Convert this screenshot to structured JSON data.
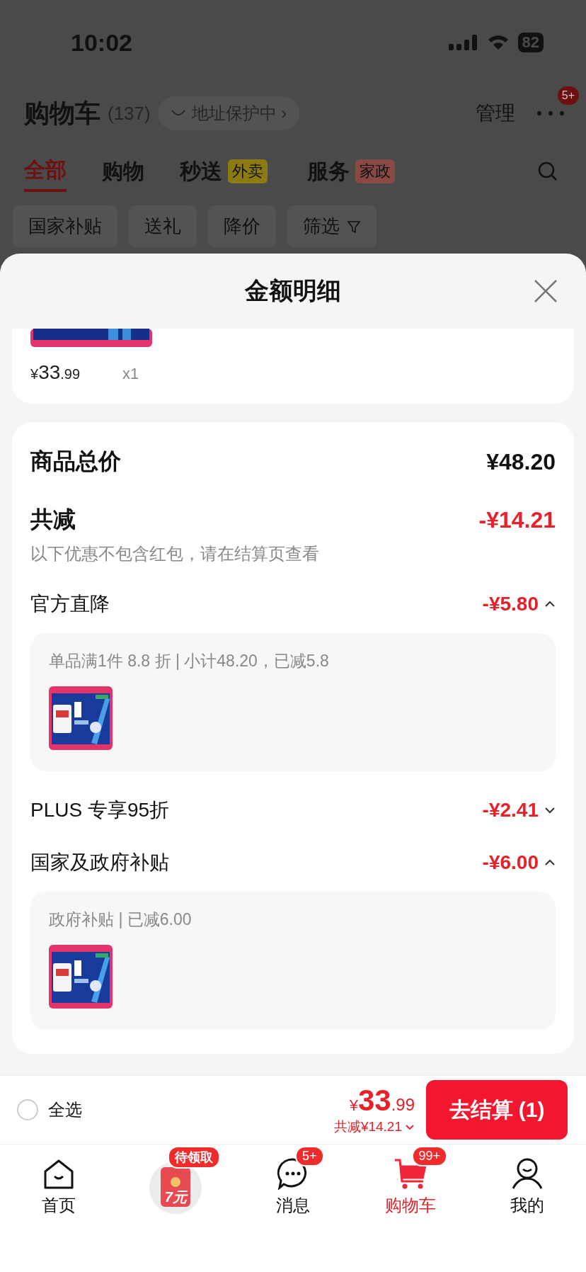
{
  "status_bar": {
    "time": "10:02",
    "battery": "82"
  },
  "header": {
    "title": "购物车",
    "count": "(137)",
    "address_badge": "地址保护中",
    "address_chevron": "›",
    "manage": "管理",
    "more_badge": "5+"
  },
  "tabs": [
    {
      "label": "全部",
      "selected": true
    },
    {
      "label": "购物",
      "selected": false
    },
    {
      "label": "秒送",
      "selected": false,
      "tag": {
        "label": "外卖",
        "color": "#8c7a12"
      }
    },
    {
      "label": "服务",
      "selected": false,
      "tag": {
        "label": "家政",
        "color": "#8a4a44"
      }
    }
  ],
  "filters": [
    {
      "label": "国家补贴",
      "kind": "chip"
    },
    {
      "label": "送礼",
      "kind": "chip"
    },
    {
      "label": "降价",
      "kind": "chip"
    },
    {
      "label": "筛选",
      "kind": "filter"
    }
  ],
  "sheet": {
    "title": "金额明细",
    "item": {
      "currency": "¥",
      "price_main": "33",
      "price_cents": ".99",
      "quantity": "x1"
    },
    "summary": {
      "total_label": "商品总价",
      "total": "¥48.20",
      "discount_label": "共减",
      "discount": "-¥14.21",
      "note": "以下优惠不包含红包，请在结算页查看"
    },
    "discounts": [
      {
        "label": "官方直降",
        "amount": "-¥5.80",
        "expanded": true,
        "detail": "单品满1件 8.8 折 | 小计48.20，已减5.8"
      },
      {
        "label": "PLUS 专享95折",
        "amount": "-¥2.41",
        "expanded": false
      },
      {
        "label": "国家及政府补贴",
        "amount": "-¥6.00",
        "expanded": true,
        "detail": "政府补贴 | 已减6.00"
      }
    ]
  },
  "checkout": {
    "select_all": {
      "label": "全选",
      "checked": false
    },
    "currency": "¥",
    "price_main": "33",
    "price_cents": ".99",
    "saved": "共减¥14.21",
    "button": "去结算 (1)"
  },
  "nav": [
    {
      "kind": "home",
      "label": "首页",
      "selected": false
    },
    {
      "kind": "promo",
      "badge": "待领取",
      "promo_text": "7元"
    },
    {
      "kind": "message",
      "label": "消息",
      "badge": "5+",
      "selected": false
    },
    {
      "kind": "cart",
      "label": "购物车",
      "badge": "99+",
      "selected": true
    },
    {
      "kind": "profile",
      "label": "我的",
      "selected": false
    }
  ]
}
